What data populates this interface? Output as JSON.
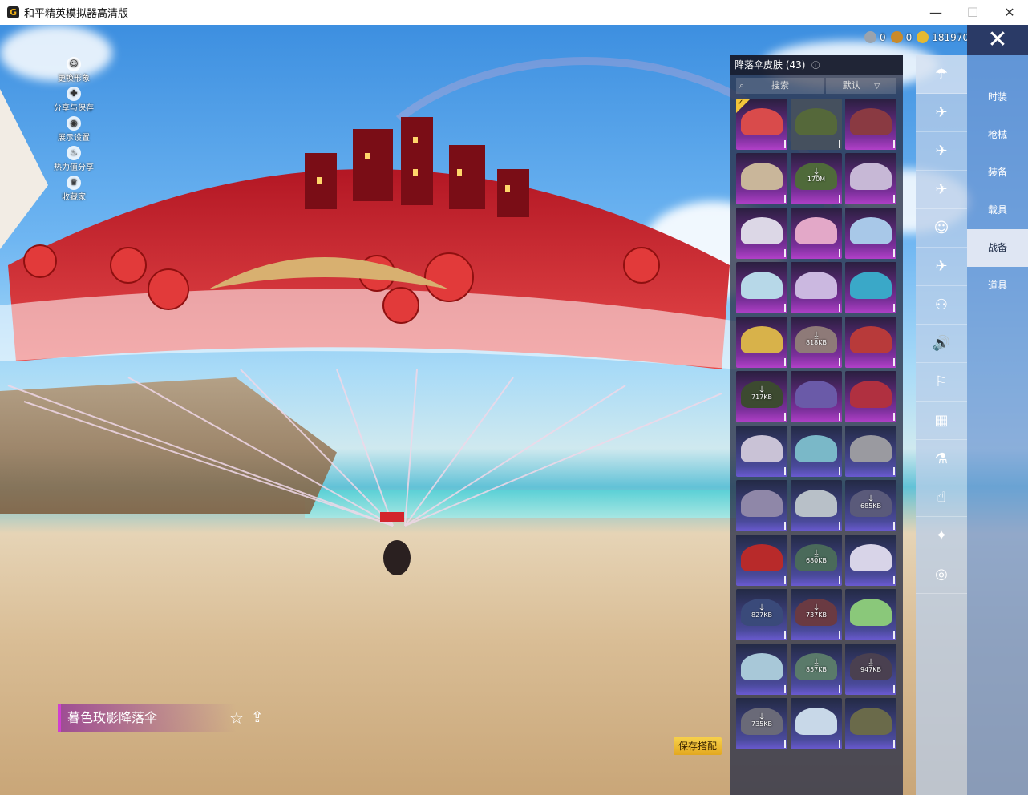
{
  "window": {
    "title": "和平精英模拟器高清版",
    "icon": "game-app-icon",
    "minimize_icon": "—",
    "maximize_icon": "☐",
    "close_icon": "✕"
  },
  "left_tools": [
    {
      "icon": "person-icon",
      "label": "更换形象"
    },
    {
      "icon": "share-icon",
      "label": "分享与保存"
    },
    {
      "icon": "eye-icon",
      "label": "展示设置"
    },
    {
      "icon": "flame-icon",
      "label": "热力值分享"
    },
    {
      "icon": "trophy-icon",
      "label": "收藏家"
    }
  ],
  "currency": [
    {
      "icon": "silver-coin-icon",
      "value": "0",
      "color": "#9aa3ad"
    },
    {
      "icon": "bronze-coin-icon",
      "value": "0",
      "color": "#c98a2a"
    },
    {
      "icon": "gold-coin-icon",
      "value": "181970",
      "color": "#e6b930"
    }
  ],
  "item_name": "暮色玫影降落伞",
  "save_button": "保存搭配",
  "panel": {
    "title": "降落伞皮肤 (43)",
    "help_icon": "ⓘ",
    "search_placeholder": "搜索",
    "sort_label": "默认"
  },
  "skins": [
    {
      "rarity": "purple",
      "color": "#d94b4b",
      "selected": true,
      "download": ""
    },
    {
      "rarity": "grey",
      "color": "#55683a",
      "download": ""
    },
    {
      "rarity": "purple",
      "color": "#8a3a42",
      "download": ""
    },
    {
      "rarity": "purple",
      "color": "#c9b69a",
      "download": ""
    },
    {
      "rarity": "purple",
      "color": "#4f6a3a",
      "download": "170M"
    },
    {
      "rarity": "purple",
      "color": "#c7b8d6",
      "download": ""
    },
    {
      "rarity": "purple",
      "color": "#dcd7e6",
      "download": ""
    },
    {
      "rarity": "purple",
      "color": "#e3a8c8",
      "download": ""
    },
    {
      "rarity": "purple",
      "color": "#a8c8e8",
      "download": ""
    },
    {
      "rarity": "purple",
      "color": "#b7d8e8",
      "download": ""
    },
    {
      "rarity": "purple",
      "color": "#cbb8e0",
      "download": ""
    },
    {
      "rarity": "purple",
      "color": "#3aa8c8",
      "download": ""
    },
    {
      "rarity": "purple",
      "color": "#d8b24a",
      "download": ""
    },
    {
      "rarity": "purple",
      "color": "#8e7a78",
      "download": "818KB"
    },
    {
      "rarity": "purple",
      "color": "#b83a3a",
      "download": ""
    },
    {
      "rarity": "purple",
      "color": "#3c4a30",
      "download": "717KB"
    },
    {
      "rarity": "purple",
      "color": "#6a5aa8",
      "download": ""
    },
    {
      "rarity": "purple",
      "color": "#b03040",
      "download": ""
    },
    {
      "rarity": "blue",
      "color": "#c9c2d6",
      "download": ""
    },
    {
      "rarity": "blue",
      "color": "#7ab8c8",
      "download": ""
    },
    {
      "rarity": "blue",
      "color": "#9a9aa0",
      "download": ""
    },
    {
      "rarity": "blue",
      "color": "#8f87a8",
      "download": ""
    },
    {
      "rarity": "blue",
      "color": "#b8c0c8",
      "download": ""
    },
    {
      "rarity": "blue",
      "color": "#5a5a7a",
      "download": "685KB"
    },
    {
      "rarity": "blue",
      "color": "#b82a2a",
      "download": ""
    },
    {
      "rarity": "blue",
      "color": "#4a6a5a",
      "download": "680KB"
    },
    {
      "rarity": "blue",
      "color": "#d8d4e8",
      "download": ""
    },
    {
      "rarity": "blue",
      "color": "#3a4a7a",
      "download": "827KB"
    },
    {
      "rarity": "blue",
      "color": "#6a3a42",
      "download": "737KB"
    },
    {
      "rarity": "blue",
      "color": "#8ac87a",
      "download": ""
    },
    {
      "rarity": "blue",
      "color": "#a8c8d8",
      "download": ""
    },
    {
      "rarity": "blue",
      "color": "#5a7a6a",
      "download": "857KB"
    },
    {
      "rarity": "blue",
      "color": "#4a4050",
      "download": "947KB"
    },
    {
      "rarity": "blue",
      "color": "#6a6a78",
      "download": "735KB"
    },
    {
      "rarity": "blue",
      "color": "#c8d8e8",
      "download": ""
    },
    {
      "rarity": "blue",
      "color": "#6a6a4a",
      "download": ""
    }
  ],
  "category_icons": [
    "parachute-icon",
    "glider-icon",
    "plane-icon",
    "jet-icon",
    "emote-icon",
    "flying-icon",
    "backpack-icon",
    "sound-icon",
    "bot-icon",
    "photo-icon",
    "extinguisher-icon",
    "tap-icon",
    "wand-icon",
    "ufo-icon"
  ],
  "category_glyphs": [
    "☂",
    "✈",
    "✈",
    "✈",
    "☺",
    "✈",
    "⚇",
    "🔊",
    "⚐",
    "▦",
    "⚗",
    "☝",
    "✦",
    "◎"
  ],
  "main_tabs": [
    {
      "label": "时装",
      "active": false
    },
    {
      "label": "枪械",
      "active": false
    },
    {
      "label": "装备",
      "active": false
    },
    {
      "label": "载具",
      "active": false
    },
    {
      "label": "战备",
      "active": true
    },
    {
      "label": "道具",
      "active": false
    }
  ]
}
